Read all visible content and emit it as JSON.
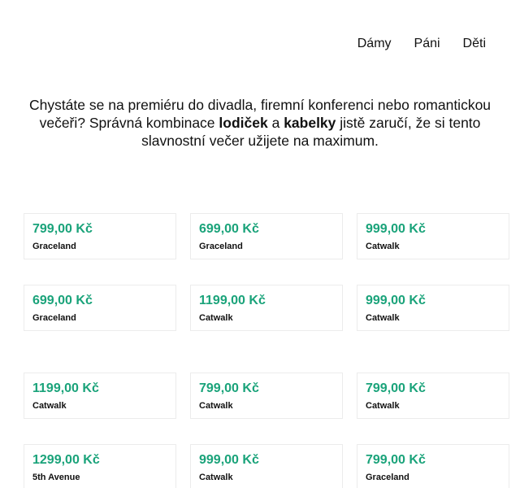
{
  "nav": {
    "items": [
      {
        "label": "Dámy"
      },
      {
        "label": "Páni"
      },
      {
        "label": "Děti"
      }
    ]
  },
  "intro": {
    "part1": "Chystáte se na premiéru do divadla, firemní konferenci nebo romantickou večeři? Správná kombinace ",
    "bold1": "lodiček",
    "part2": " a ",
    "bold2": "kabelky",
    "part3": " jistě zaručí, že si tento slavnostní večer užijete na maximum."
  },
  "products": [
    {
      "price": "799,00 Kč",
      "brand": "Graceland"
    },
    {
      "price": "699,00 Kč",
      "brand": "Graceland"
    },
    {
      "price": "999,00 Kč",
      "brand": "Catwalk"
    },
    {
      "price": "699,00 Kč",
      "brand": "Graceland"
    },
    {
      "price": "1199,00 Kč",
      "brand": "Catwalk"
    },
    {
      "price": "999,00 Kč",
      "brand": "Catwalk"
    },
    {
      "price": "1199,00 Kč",
      "brand": "Catwalk"
    },
    {
      "price": "799,00 Kč",
      "brand": "Catwalk"
    },
    {
      "price": "799,00 Kč",
      "brand": "Catwalk"
    },
    {
      "price": "1299,00 Kč",
      "brand": "5th Avenue"
    },
    {
      "price": "999,00 Kč",
      "brand": "Catwalk"
    },
    {
      "price": "799,00 Kč",
      "brand": "Graceland"
    }
  ]
}
